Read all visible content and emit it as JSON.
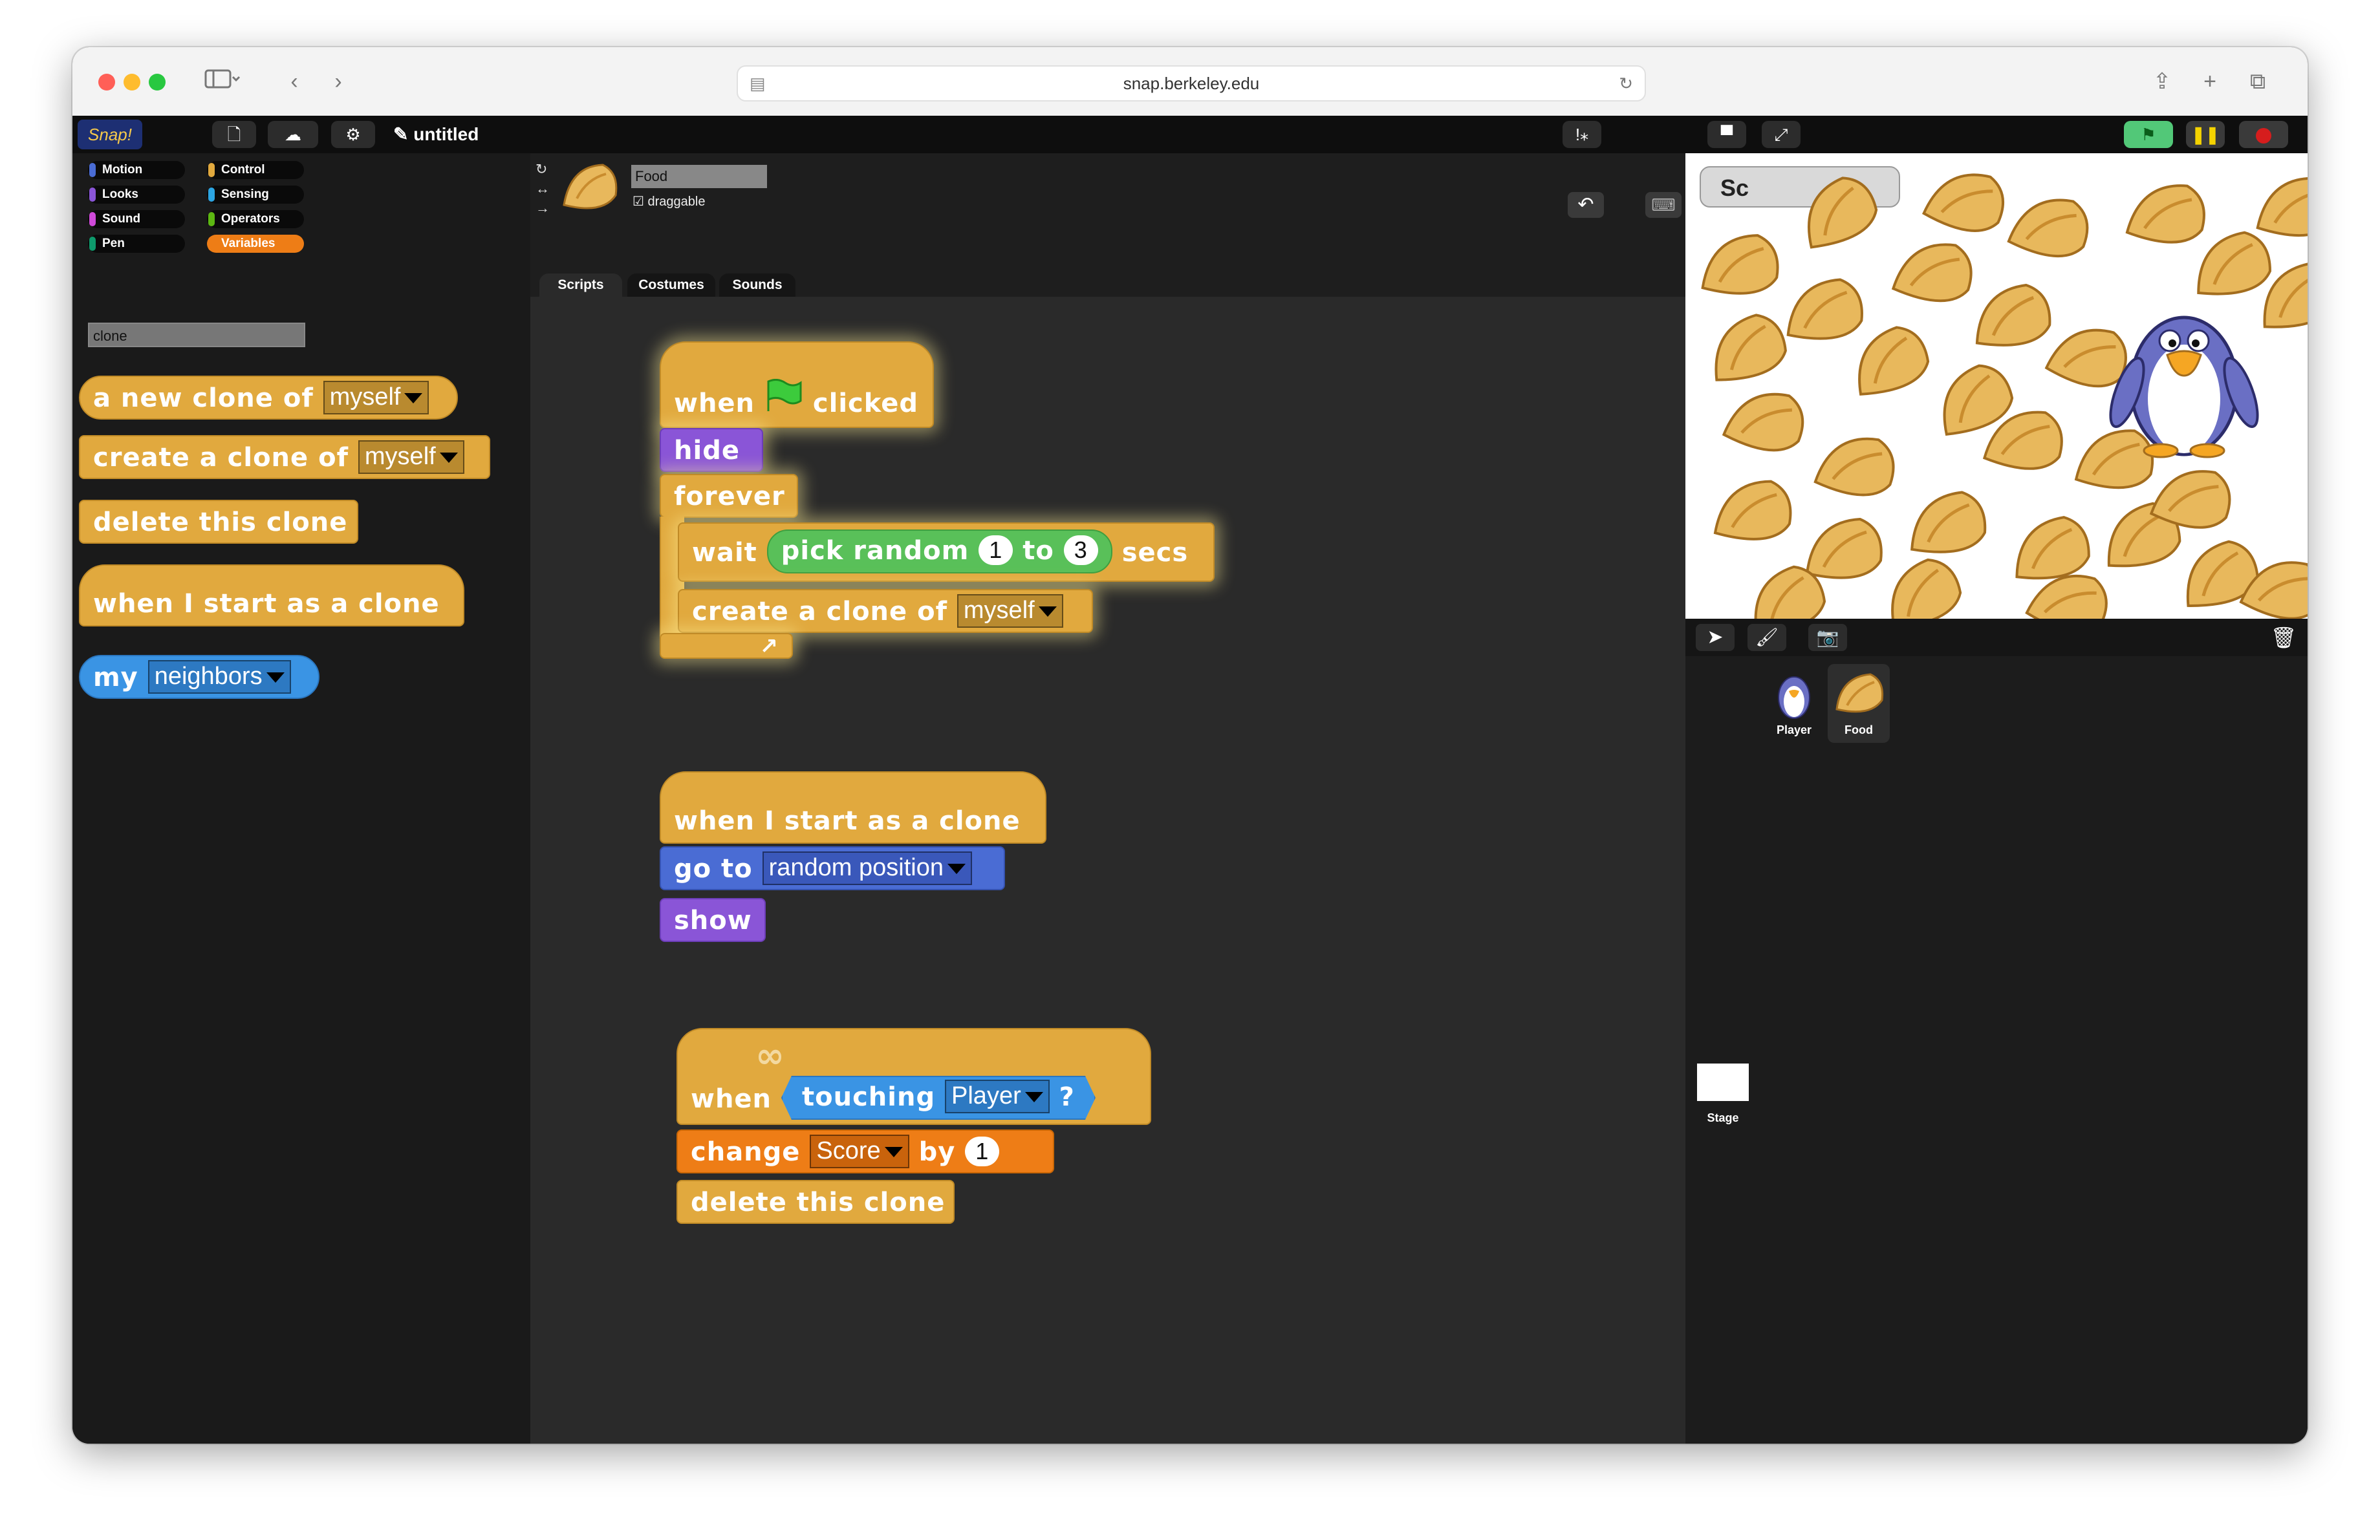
{
  "browser": {
    "url": "snap.berkeley.edu"
  },
  "snap": {
    "logo": "Snap!",
    "project_title": "untitled",
    "categories": [
      {
        "label": "Motion",
        "color": "#4a6cd4"
      },
      {
        "label": "Control",
        "color": "#e1a93e"
      },
      {
        "label": "Looks",
        "color": "#8a55d7"
      },
      {
        "label": "Sensing",
        "color": "#2ca5e2"
      },
      {
        "label": "Sound",
        "color": "#cf4ad9"
      },
      {
        "label": "Operators",
        "color": "#5cb712"
      },
      {
        "label": "Pen",
        "color": "#0e9a6c"
      },
      {
        "label": "Variables",
        "color": "#ee7d16"
      }
    ],
    "palette_search": "clone",
    "palette_blocks": {
      "new_clone": {
        "text": "a new clone of",
        "dropdown": "myself"
      },
      "create_clone": {
        "text": "create a clone of",
        "dropdown": "myself"
      },
      "delete_clone": {
        "text": "delete this clone"
      },
      "when_start_clone": {
        "text": "when I start as a clone"
      },
      "my": {
        "text": "my",
        "dropdown": "neighbors"
      }
    },
    "sprite": {
      "name": "Food",
      "draggable_label": "draggable",
      "tabs": [
        "Scripts",
        "Costumes",
        "Sounds"
      ]
    },
    "script1": {
      "when": "when",
      "clicked": "clicked",
      "hide": "hide",
      "forever": "forever",
      "wait": "wait",
      "pick_random": "pick random",
      "from": "1",
      "to": "to",
      "to_val": "3",
      "secs": "secs",
      "create_clone": "create a clone of",
      "create_dd": "myself"
    },
    "script2": {
      "hat": "when I start as a clone",
      "go_to": "go to",
      "go_dd": "random position",
      "show": "show"
    },
    "script3": {
      "when": "when",
      "touching": "touching",
      "touching_dd": "Player",
      "q": "?",
      "change": "change",
      "change_dd": "Score",
      "by": "by",
      "by_val": "1",
      "delete": "delete this clone"
    },
    "corral": {
      "sprites": [
        {
          "label": "Player"
        },
        {
          "label": "Food"
        }
      ],
      "stage_label": "Stage"
    },
    "stage_watcher_partial": "Sc"
  }
}
